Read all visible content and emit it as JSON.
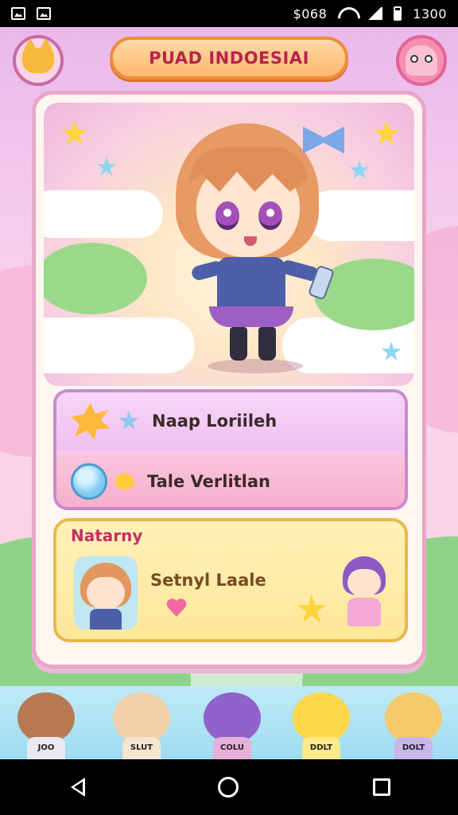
{
  "status_bar": {
    "left_icons": [
      "image-icon",
      "gallery-icon"
    ],
    "signal_text": "$068",
    "time": "1300"
  },
  "header": {
    "title": "PUAD INDOESIAI",
    "left_button_icon": "fox-avatar-icon",
    "right_button_icon": "pink-ghost-icon"
  },
  "menu": {
    "items": [
      {
        "label": "Naap Loriileh",
        "icon": "sun-creature-icon",
        "badge_icon": "blue-star-icon"
      },
      {
        "label": "Tale Verlitlan",
        "icon": "bubble-creature-icon",
        "badge_icon": "yellow-bird-icon"
      }
    ]
  },
  "friends": {
    "title": "Natarny",
    "friend_name": "Setnyl Laale"
  },
  "bottom_characters": [
    {
      "name": "bear",
      "tag": "JOO",
      "color": "#b77a52"
    },
    {
      "name": "hamster",
      "tag": "SLUT",
      "color": "#f3cfa8"
    },
    {
      "name": "purple-girl",
      "tag": "COLU",
      "color": "#8f63c9"
    },
    {
      "name": "yellow-chick",
      "tag": "DDLT",
      "color": "#ffd84a"
    },
    {
      "name": "blonde-girl",
      "tag": "DOLT",
      "color": "#f5c86a"
    }
  ],
  "nav": {
    "back_icon": "back-triangle-icon",
    "home_icon": "home-circle-icon",
    "recent_icon": "recent-square-icon"
  },
  "colors": {
    "accent_pink": "#c86ba3",
    "title_orange": "#f08a3c",
    "title_text": "#b8234a",
    "menu_border": "#c98ad0",
    "friends_border": "#e8b84d"
  }
}
